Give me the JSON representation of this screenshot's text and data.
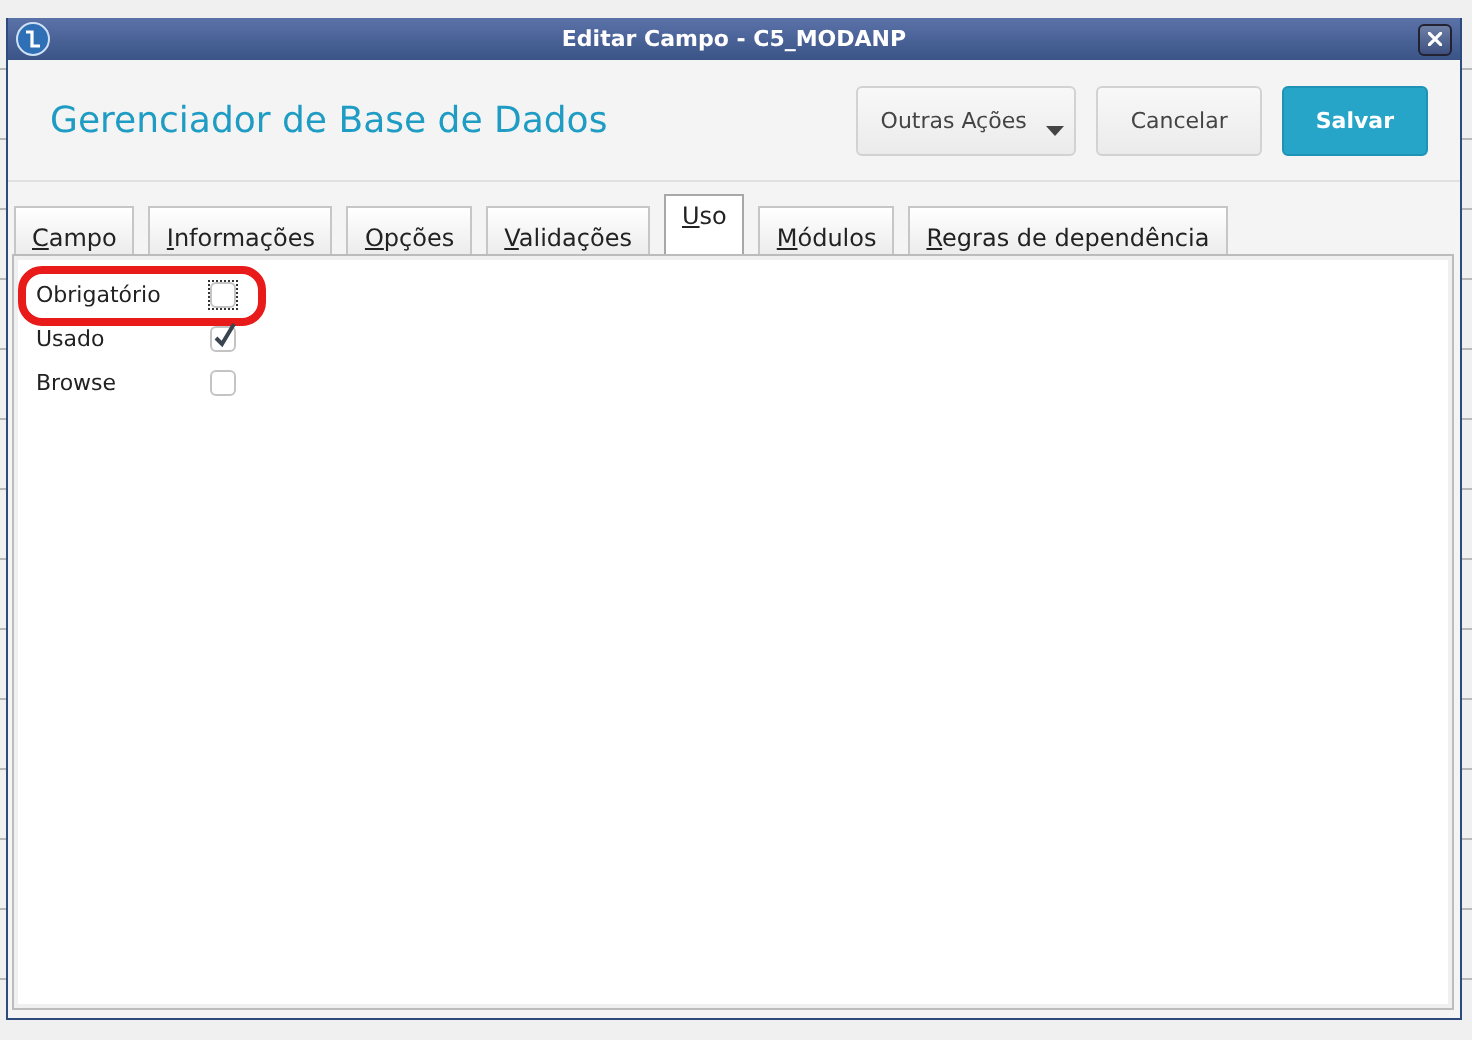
{
  "window": {
    "title": "Editar Campo - C5_MODANP"
  },
  "header": {
    "title": "Gerenciador de Base de Dados",
    "buttons": [
      {
        "label": "Outras Ações",
        "kind": "menu"
      },
      {
        "label": "Cancelar",
        "kind": "plain"
      },
      {
        "label": "Salvar",
        "kind": "primary"
      }
    ]
  },
  "tabs": [
    {
      "label": "Campo",
      "underline_first": true,
      "selected": false
    },
    {
      "label": "Informações",
      "underline_first": true,
      "selected": false
    },
    {
      "label": "Opções",
      "underline_first": true,
      "selected": false
    },
    {
      "label": "Validações",
      "underline_first": true,
      "selected": false
    },
    {
      "label": "Uso",
      "underline_first": true,
      "selected": true
    },
    {
      "label": "Módulos",
      "underline_first": true,
      "selected": false
    },
    {
      "label": "Regras de dependência",
      "underline_first": true,
      "selected": false
    }
  ],
  "options": [
    {
      "label": "Obrigatório",
      "checked": false,
      "focused": true,
      "highlighted": true
    },
    {
      "label": "Usado",
      "checked": true,
      "focused": false,
      "highlighted": false
    },
    {
      "label": "Browse",
      "checked": false,
      "focused": false,
      "highlighted": false
    }
  ]
}
